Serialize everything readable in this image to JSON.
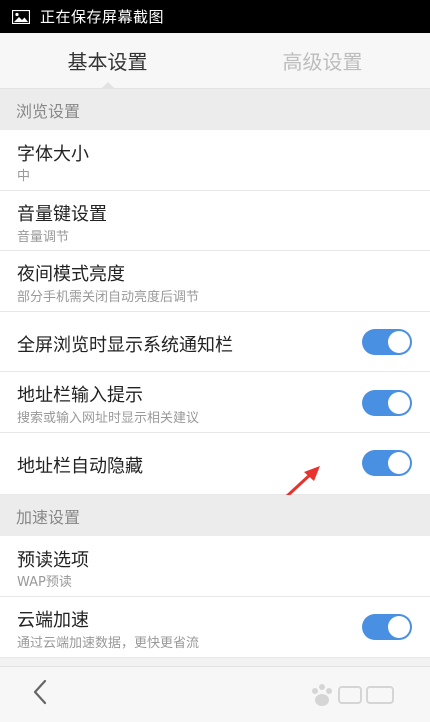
{
  "status_bar": {
    "icon": "picture-icon",
    "text": "正在保存屏幕截图"
  },
  "tabs": [
    {
      "label": "基本设置",
      "active": true
    },
    {
      "label": "高级设置",
      "active": false
    }
  ],
  "sections": [
    {
      "header": "浏览设置",
      "items": [
        {
          "title": "字体大小",
          "subtitle": "中",
          "toggle": null
        },
        {
          "title": "音量键设置",
          "subtitle": "音量调节",
          "toggle": null
        },
        {
          "title": "夜间模式亮度",
          "subtitle": "部分手机需关闭自动亮度后调节",
          "toggle": null
        },
        {
          "title": "全屏浏览时显示系统通知栏",
          "subtitle": "",
          "toggle": true
        },
        {
          "title": "地址栏输入提示",
          "subtitle": "搜索或输入网址时显示相关建议",
          "toggle": true
        },
        {
          "title": "地址栏自动隐藏",
          "subtitle": "",
          "toggle": true
        }
      ]
    },
    {
      "header": "加速设置",
      "items": [
        {
          "title": "预读选项",
          "subtitle": "WAP预读",
          "toggle": null
        },
        {
          "title": "云端加速",
          "subtitle": "通过云端加速数据，更快更省流",
          "toggle": true
        }
      ]
    }
  ],
  "bottom_bar": {
    "back_icon": "chevron-left-icon"
  },
  "colors": {
    "toggle_on": "#4a90e2",
    "annotation_arrow": "#e8322e"
  }
}
